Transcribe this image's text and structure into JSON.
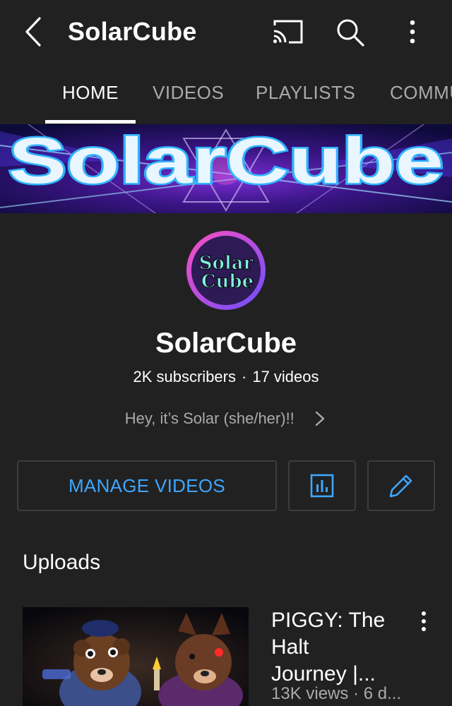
{
  "header": {
    "title": "SolarCube",
    "back_icon": "chevron-left-icon",
    "cast_icon": "cast-icon",
    "search_icon": "search-icon",
    "more_icon": "more-vert-icon"
  },
  "tabs": [
    {
      "label": "HOME",
      "active": true
    },
    {
      "label": "VIDEOS",
      "active": false
    },
    {
      "label": "PLAYLISTS",
      "active": false
    },
    {
      "label": "COMMUNITY",
      "active": false
    }
  ],
  "banner": {
    "text": "SolarCube"
  },
  "channel": {
    "avatar_text_line1": "Solar",
    "avatar_text_line2": "Cube",
    "name": "SolarCube",
    "subscribers": "2K subscribers",
    "separator": "·",
    "videos": "17 videos",
    "about": "Hey, it’s Solar (she/her)!!"
  },
  "actions": {
    "manage_label": "MANAGE VIDEOS",
    "analytics_icon": "analytics-icon",
    "edit_icon": "edit-pencil-icon"
  },
  "uploads": {
    "section_title": "Uploads",
    "videos": [
      {
        "title_lines": [
          "PIGGY: The",
          "Halt",
          "Journey |..."
        ],
        "meta": "13K views · 6 d..."
      }
    ]
  },
  "colors": {
    "background": "#212121",
    "accent": "#3ea6ff",
    "secondary_text": "#aaaaaa"
  }
}
